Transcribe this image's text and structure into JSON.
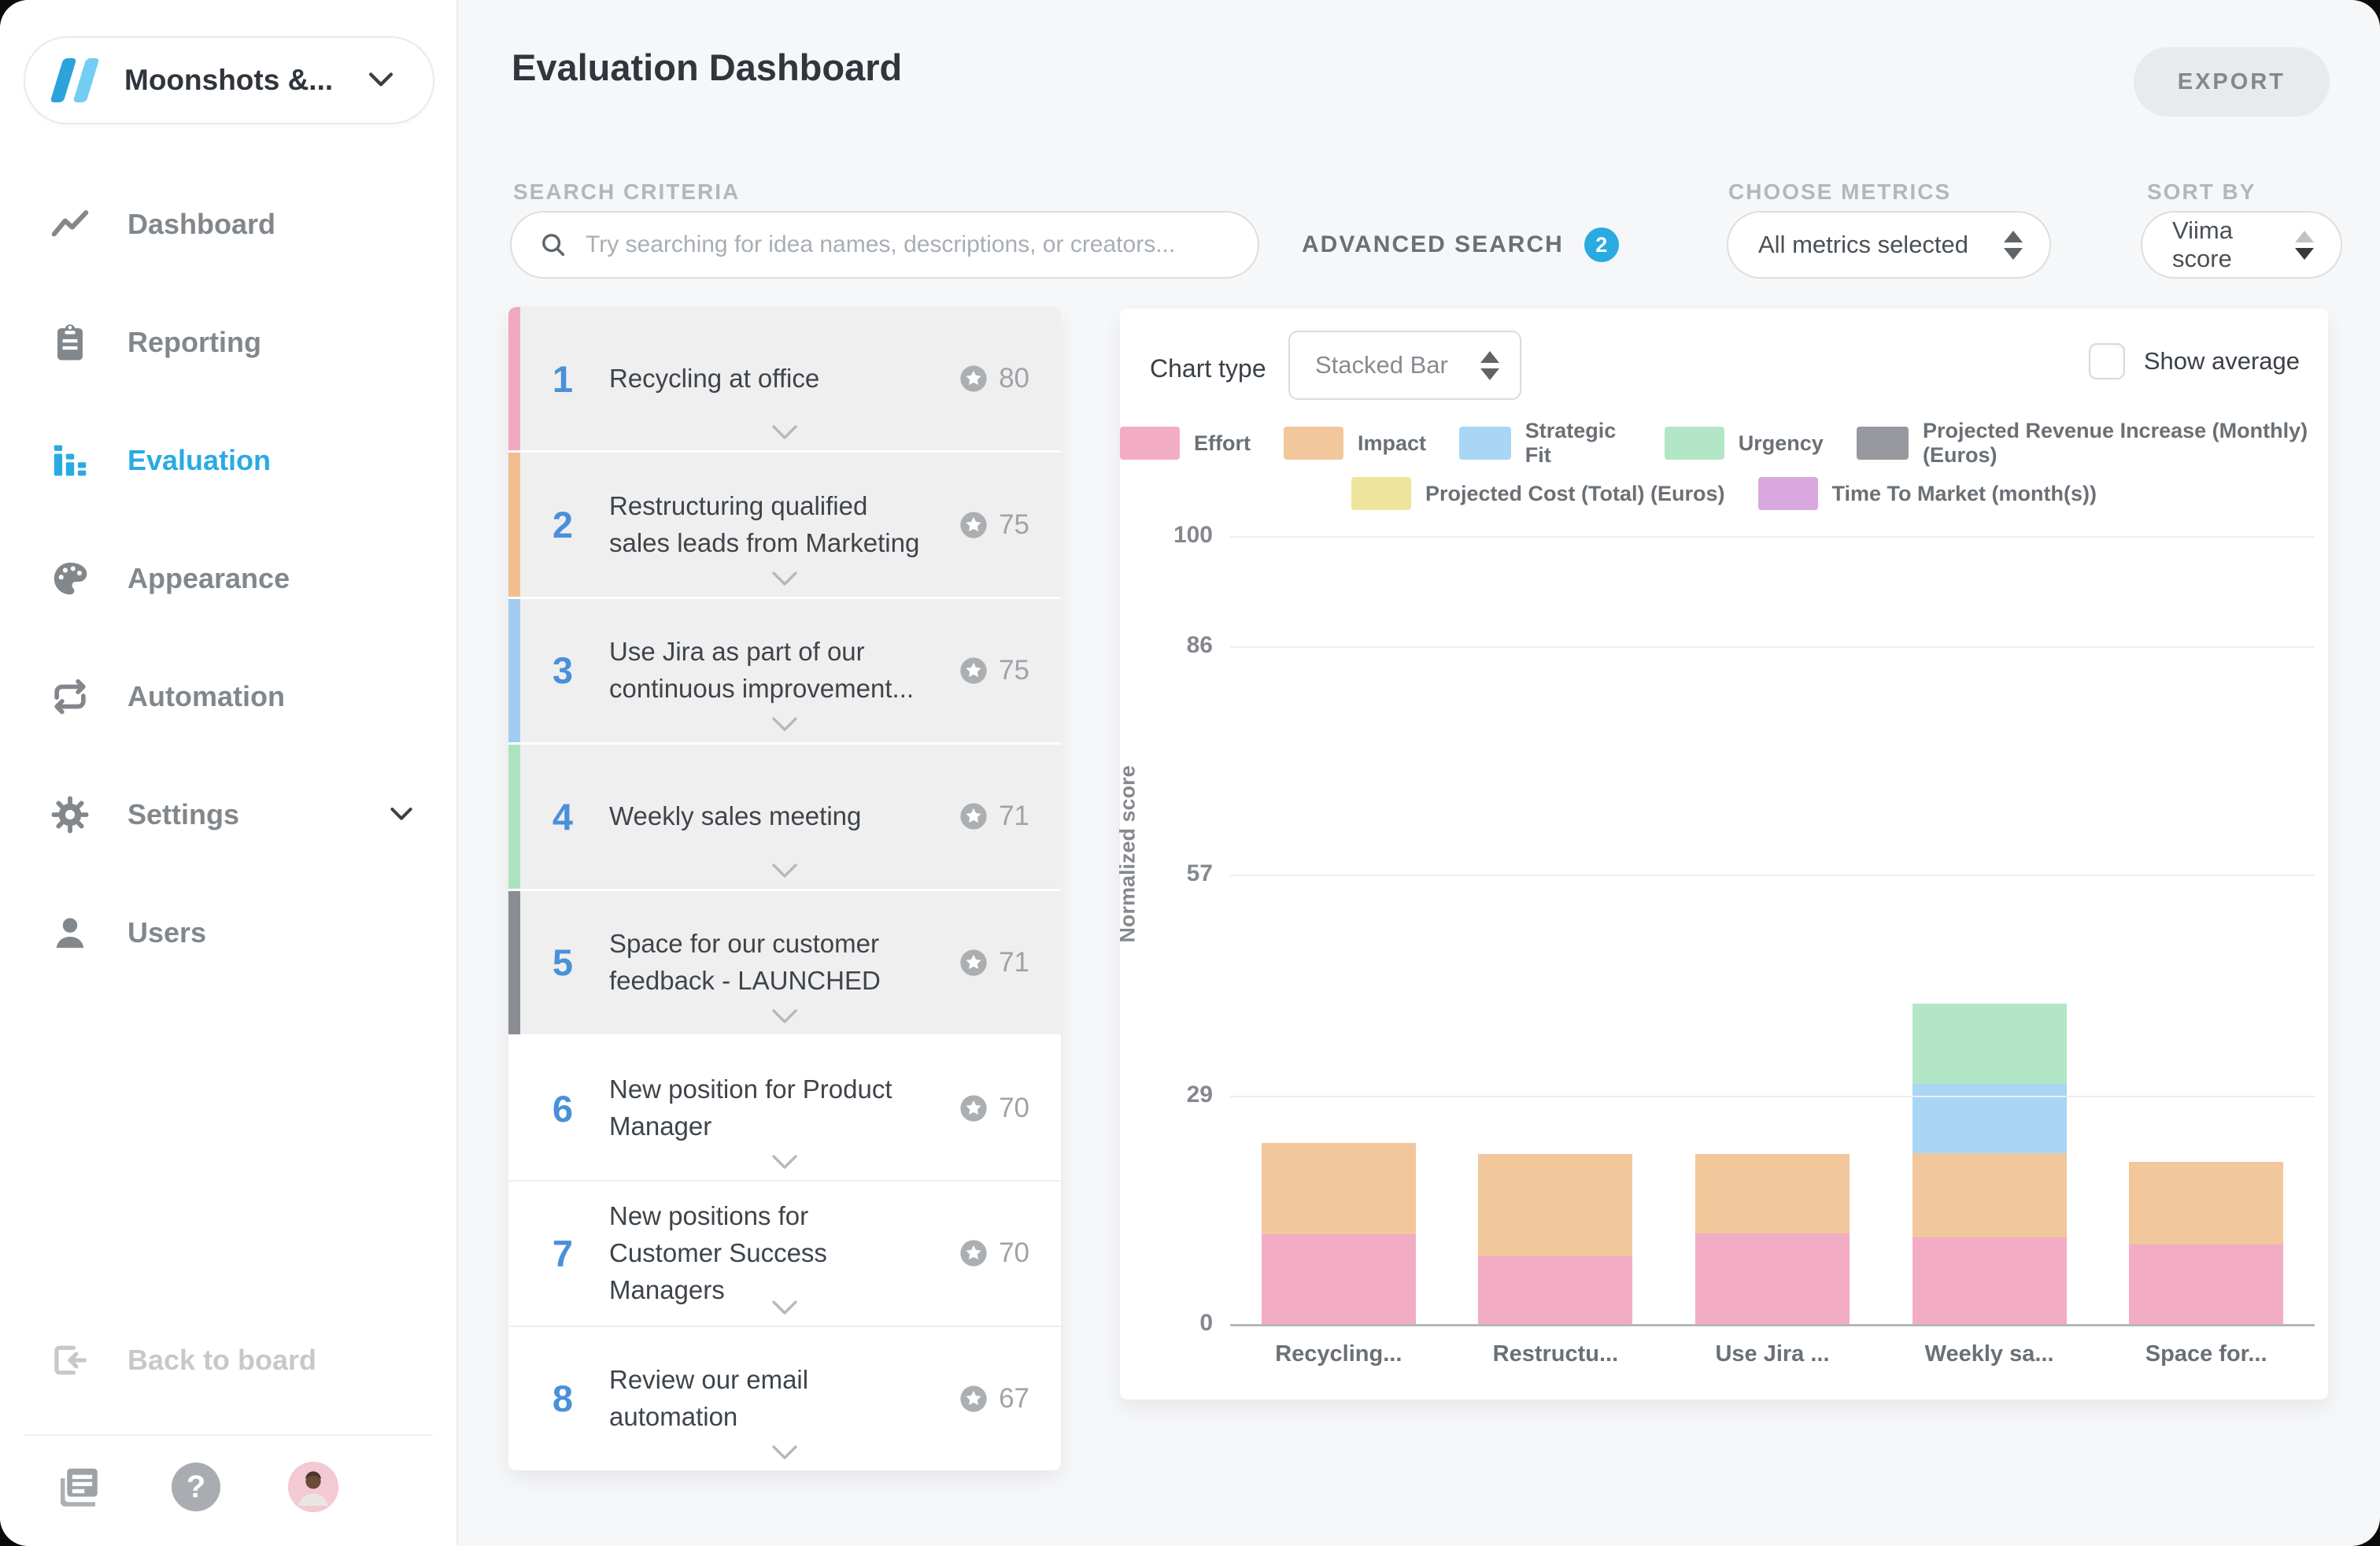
{
  "sidebar": {
    "workspace_name": "Moonshots &...",
    "nav": [
      {
        "label": "Dashboard",
        "icon": "line-chart-icon",
        "active": false,
        "chevron": false
      },
      {
        "label": "Reporting",
        "icon": "clipboard-icon",
        "active": false,
        "chevron": false
      },
      {
        "label": "Evaluation",
        "icon": "bar-chart-icon",
        "active": true,
        "chevron": false
      },
      {
        "label": "Appearance",
        "icon": "palette-icon",
        "active": false,
        "chevron": false
      },
      {
        "label": "Automation",
        "icon": "repeat-icon",
        "active": false,
        "chevron": false
      },
      {
        "label": "Settings",
        "icon": "gear-icon",
        "active": false,
        "chevron": true
      },
      {
        "label": "Users",
        "icon": "person-icon",
        "active": false,
        "chevron": false
      }
    ],
    "back_label": "Back to board",
    "help_glyph": "?"
  },
  "header": {
    "title": "Evaluation Dashboard",
    "export_label": "EXPORT"
  },
  "filters": {
    "search_label": "SEARCH CRITERIA",
    "search_placeholder": "Try searching for idea names, descriptions, or creators...",
    "search_value": "",
    "advanced_label": "ADVANCED SEARCH",
    "advanced_count": "2",
    "metrics_label": "CHOOSE METRICS",
    "metrics_value": "All metrics selected",
    "sort_label": "SORT BY",
    "sort_value": "Viima score"
  },
  "idea_list": [
    {
      "rank": "1",
      "title": "Recycling at office",
      "score": "80",
      "bar_color": "#F0A9BF",
      "shaded": true
    },
    {
      "rank": "2",
      "title": "Restructuring qualified sales leads from Marketing",
      "score": "75",
      "bar_color": "#F2BE90",
      "shaded": true
    },
    {
      "rank": "3",
      "title": "Use Jira as part of our continuous improvement...",
      "score": "75",
      "bar_color": "#A2CCEF",
      "shaded": true
    },
    {
      "rank": "4",
      "title": "Weekly sales meeting",
      "score": "71",
      "bar_color": "#ACE3BE",
      "shaded": true
    },
    {
      "rank": "5",
      "title": "Space for our customer feedback - LAUNCHED",
      "score": "71",
      "bar_color": "#8A8D91",
      "shaded": true
    },
    {
      "rank": "6",
      "title": "New position for Product Manager",
      "score": "70",
      "bar_color": null,
      "shaded": false
    },
    {
      "rank": "7",
      "title": "New positions for Customer Success Managers",
      "score": "70",
      "bar_color": null,
      "shaded": false
    },
    {
      "rank": "8",
      "title": "Review our email automation",
      "score": "67",
      "bar_color": null,
      "shaded": false
    }
  ],
  "chart": {
    "chart_type_label": "Chart type",
    "chart_type_value": "Stacked Bar",
    "show_average_label": "Show average",
    "average_checked": false
  },
  "chart_data": {
    "type": "bar",
    "stacked": true,
    "title": "",
    "xlabel": "",
    "ylabel": "Normalized score",
    "ylim": [
      0,
      100
    ],
    "yticks": [
      100,
      86,
      57,
      29,
      0
    ],
    "grid": true,
    "legend_position": "top",
    "legend_rows": [
      [
        0,
        1,
        2,
        3,
        4
      ],
      [
        5,
        6
      ]
    ],
    "categories": [
      "Recycling...",
      "Restructu...",
      "Use Jira ...",
      "Weekly sa...",
      "Space for..."
    ],
    "series": [
      {
        "name": "Effort",
        "color": "#F2ACC3",
        "values": [
          11.4,
          8.6,
          11.5,
          11.0,
          10.1
        ]
      },
      {
        "name": "Impact",
        "color": "#F2C79C",
        "values": [
          11.6,
          13.0,
          10.1,
          10.7,
          10.5
        ]
      },
      {
        "name": "Strategic Fit",
        "color": "#A9D6F5",
        "values": [
          0,
          0,
          0,
          8.8,
          0
        ]
      },
      {
        "name": "Urgency",
        "color": "#B2E6C6",
        "values": [
          0,
          0,
          0,
          10.2,
          0
        ]
      },
      {
        "name": "Projected Revenue Increase (Monthly) (Euros)",
        "color": "#97999E",
        "values": [
          0,
          0,
          0,
          0,
          0
        ]
      },
      {
        "name": "Projected Cost (Total) (Euros)",
        "color": "#EFE49B",
        "values": [
          0,
          0,
          0,
          0,
          0
        ]
      },
      {
        "name": "Time To Market (month(s))",
        "color": "#D9A8DE",
        "values": [
          0,
          0,
          0,
          0,
          0
        ]
      }
    ]
  }
}
